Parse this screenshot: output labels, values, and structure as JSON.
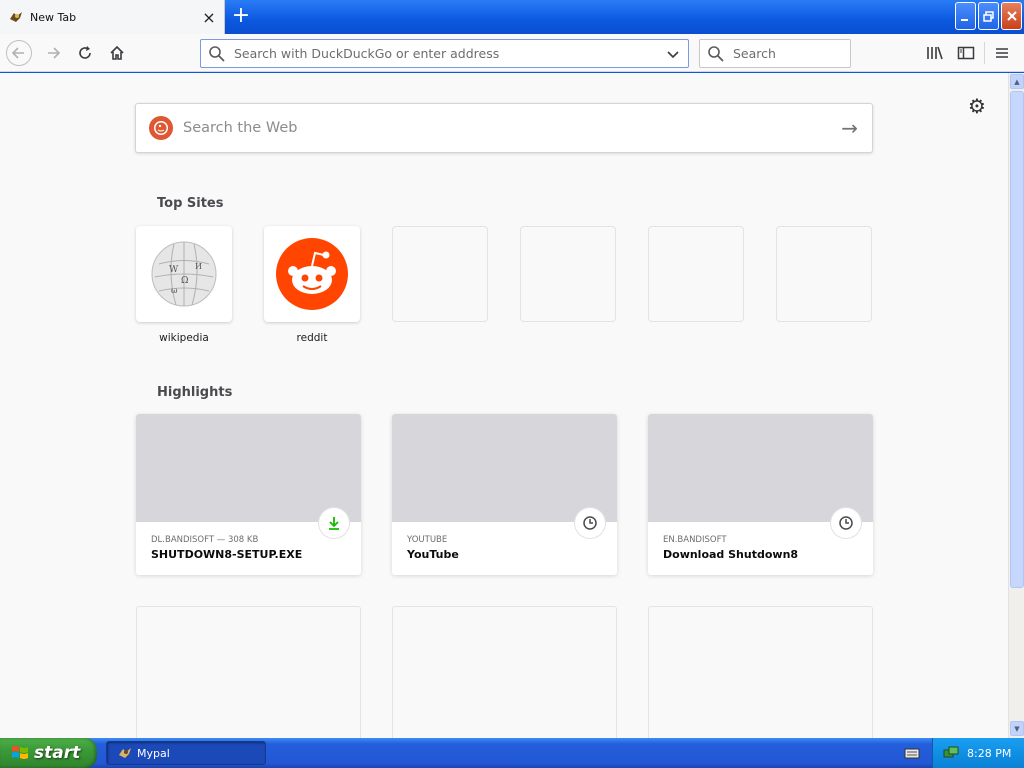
{
  "window": {
    "tab_title": "New Tab",
    "tab_close": "×",
    "new_tab": "+"
  },
  "navbar": {
    "url_placeholder": "Search with DuckDuckGo or enter address",
    "search_placeholder": "Search"
  },
  "newtab": {
    "web_search_placeholder": "Search the Web",
    "top_sites_title": "Top Sites",
    "top_sites": [
      {
        "label": "wikipedia",
        "icon": "wikipedia-icon"
      },
      {
        "label": "reddit",
        "icon": "reddit-icon"
      },
      {
        "label": ""
      },
      {
        "label": ""
      },
      {
        "label": ""
      },
      {
        "label": ""
      }
    ],
    "highlights_title": "Highlights",
    "highlights": [
      {
        "context": "DL.BANDISOFT — 308 KB",
        "title": "SHUTDOWN8-SETUP.EXE",
        "badge": "download-icon"
      },
      {
        "context": "YOUTUBE",
        "title": "YouTube",
        "badge": "clock-icon"
      },
      {
        "context": "EN.BANDISOFT",
        "title": "Download Shutdown8",
        "badge": "clock-icon"
      }
    ]
  },
  "taskbar": {
    "start_label": "start",
    "task_label": "Mypal",
    "clock": "8:28 PM"
  },
  "colors": {
    "titlebar": "#0b58df",
    "duckduckgo": "#de5833",
    "reddit": "#ff4500",
    "download_badge": "#12bc00"
  }
}
